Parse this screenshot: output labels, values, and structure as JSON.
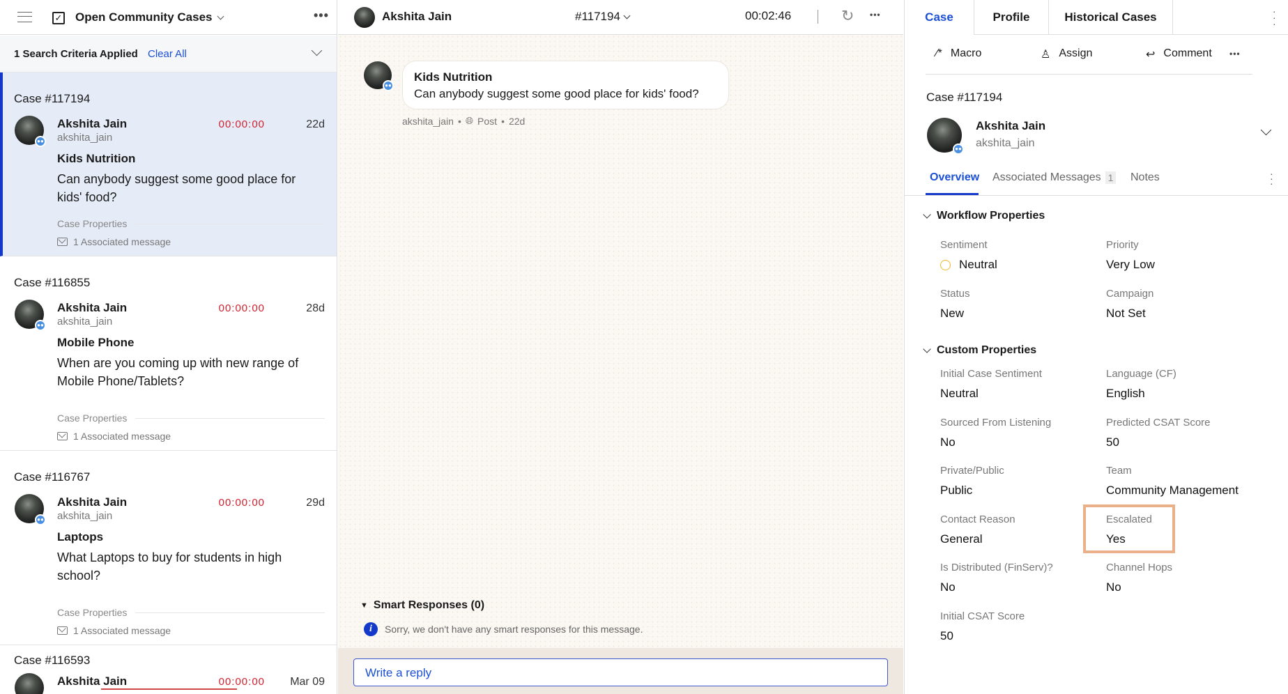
{
  "left": {
    "view_title": "Open Community Cases",
    "criteria": "1 Search Criteria Applied",
    "clear_all": "Clear All",
    "cases": [
      {
        "number": "Case #117194",
        "name": "Akshita Jain",
        "handle": "akshita_jain",
        "timer": "00:00:00",
        "age": "22d",
        "title": "Kids Nutrition",
        "text": "Can anybody suggest some good place for kids' food?",
        "props_label": "Case Properties",
        "assoc": "1 Associated message"
      },
      {
        "number": "Case #116855",
        "name": "Akshita Jain",
        "handle": "akshita_jain",
        "timer": "00:00:00",
        "age": "28d",
        "title": "Mobile Phone",
        "text": "When are you coming up with new range of Mobile Phone/Tablets?",
        "props_label": "Case Properties",
        "assoc": "1 Associated message"
      },
      {
        "number": "Case #116767",
        "name": "Akshita Jain",
        "handle": "akshita_jain",
        "timer": "00:00:00",
        "age": "29d",
        "title": "Laptops",
        "text": "What Laptops to buy for students in high school?",
        "props_label": "Case Properties",
        "assoc": "1 Associated message"
      },
      {
        "number": "Case #116593",
        "name": "Akshita Jain",
        "timer": "00:00:00",
        "age": "Mar 09"
      }
    ]
  },
  "middle": {
    "name": "Akshita Jain",
    "case_id": "#117194",
    "timer": "00:02:46",
    "message": {
      "title": "Kids Nutrition",
      "text": "Can anybody suggest some good place for kids' food?",
      "handle": "akshita_jain",
      "type": "Post",
      "age": "22d"
    },
    "smart_responses": "Smart Responses (0)",
    "smart_empty": "Sorry, we don't have any smart responses for this message.",
    "reply_placeholder": "Write a reply"
  },
  "right": {
    "tabs": [
      "Case",
      "Profile",
      "Historical Cases"
    ],
    "actions": {
      "macro": "Macro",
      "assign": "Assign",
      "comment": "Comment"
    },
    "case_number": "Case #117194",
    "name": "Akshita Jain",
    "handle": "akshita_jain",
    "subtabs": {
      "overview": "Overview",
      "assoc": "Associated Messages",
      "assoc_count": "1",
      "notes": "Notes"
    },
    "workflow_title": "Workflow Properties",
    "workflow": [
      {
        "label": "Sentiment",
        "value": "Neutral"
      },
      {
        "label": "Priority",
        "value": "Very Low"
      },
      {
        "label": "Status",
        "value": "New"
      },
      {
        "label": "Campaign",
        "value": "Not Set"
      }
    ],
    "custom_title": "Custom Properties",
    "custom": [
      {
        "label": "Initial Case Sentiment",
        "value": "Neutral"
      },
      {
        "label": "Language (CF)",
        "value": "English"
      },
      {
        "label": "Sourced From Listening",
        "value": "No"
      },
      {
        "label": "Predicted CSAT Score",
        "value": "50"
      },
      {
        "label": "Private/Public",
        "value": "Public"
      },
      {
        "label": "Team",
        "value": "Community Management"
      },
      {
        "label": "Contact Reason",
        "value": "General"
      },
      {
        "label": "Escalated",
        "value": "Yes"
      },
      {
        "label": "Is Distributed (FinServ)?",
        "value": "No"
      },
      {
        "label": "Channel Hops",
        "value": "No"
      },
      {
        "label": "Initial CSAT Score",
        "value": "50"
      }
    ]
  },
  "colors": {
    "accent": "#1a4fd6",
    "timer_red": "#d0212e",
    "selected_bg": "#e6ecf7",
    "highlight_box": "#e9b089"
  }
}
